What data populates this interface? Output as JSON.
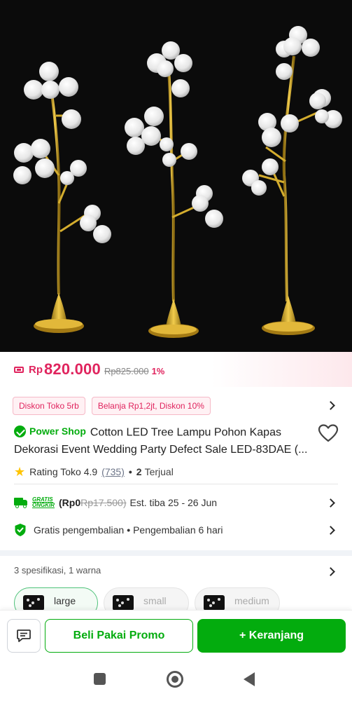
{
  "product": {
    "price_currency": "Rp",
    "price": "820.000",
    "price_original": "Rp825.000",
    "discount": "1%",
    "promos": [
      "Diskon Toko 5rb",
      "Belanja Rp1,2jt, Diskon 10%"
    ],
    "badge": "Power Shop",
    "title": "Cotton LED Tree Lampu Pohon Kapas Dekorasi Event Wedding Party Defect Sale LED-83DAE (...",
    "rating_label": "Rating Toko 4.9",
    "rating_count": "(735)",
    "sold_count": "2",
    "sold_label": "Terjual"
  },
  "shipping": {
    "gratis_line1": "GRATIS",
    "gratis_line2": "ONGKIR",
    "free_price": "(Rp0",
    "old_price": "Rp17.500)",
    "estimate": "Est. tiba 25 - 26 Jun"
  },
  "returns": {
    "label": "Gratis pengembalian",
    "period": "Pengembalian 6 hari"
  },
  "specs": {
    "summary": "3 spesifikasi, 1 warna",
    "variants": [
      "large",
      "small",
      "medium"
    ]
  },
  "actions": {
    "buy_promo": "Beli Pakai Promo",
    "add_cart": "+ Keranjang"
  },
  "colors": {
    "brand_green": "#03ac0e",
    "price_red": "#e0245e"
  }
}
